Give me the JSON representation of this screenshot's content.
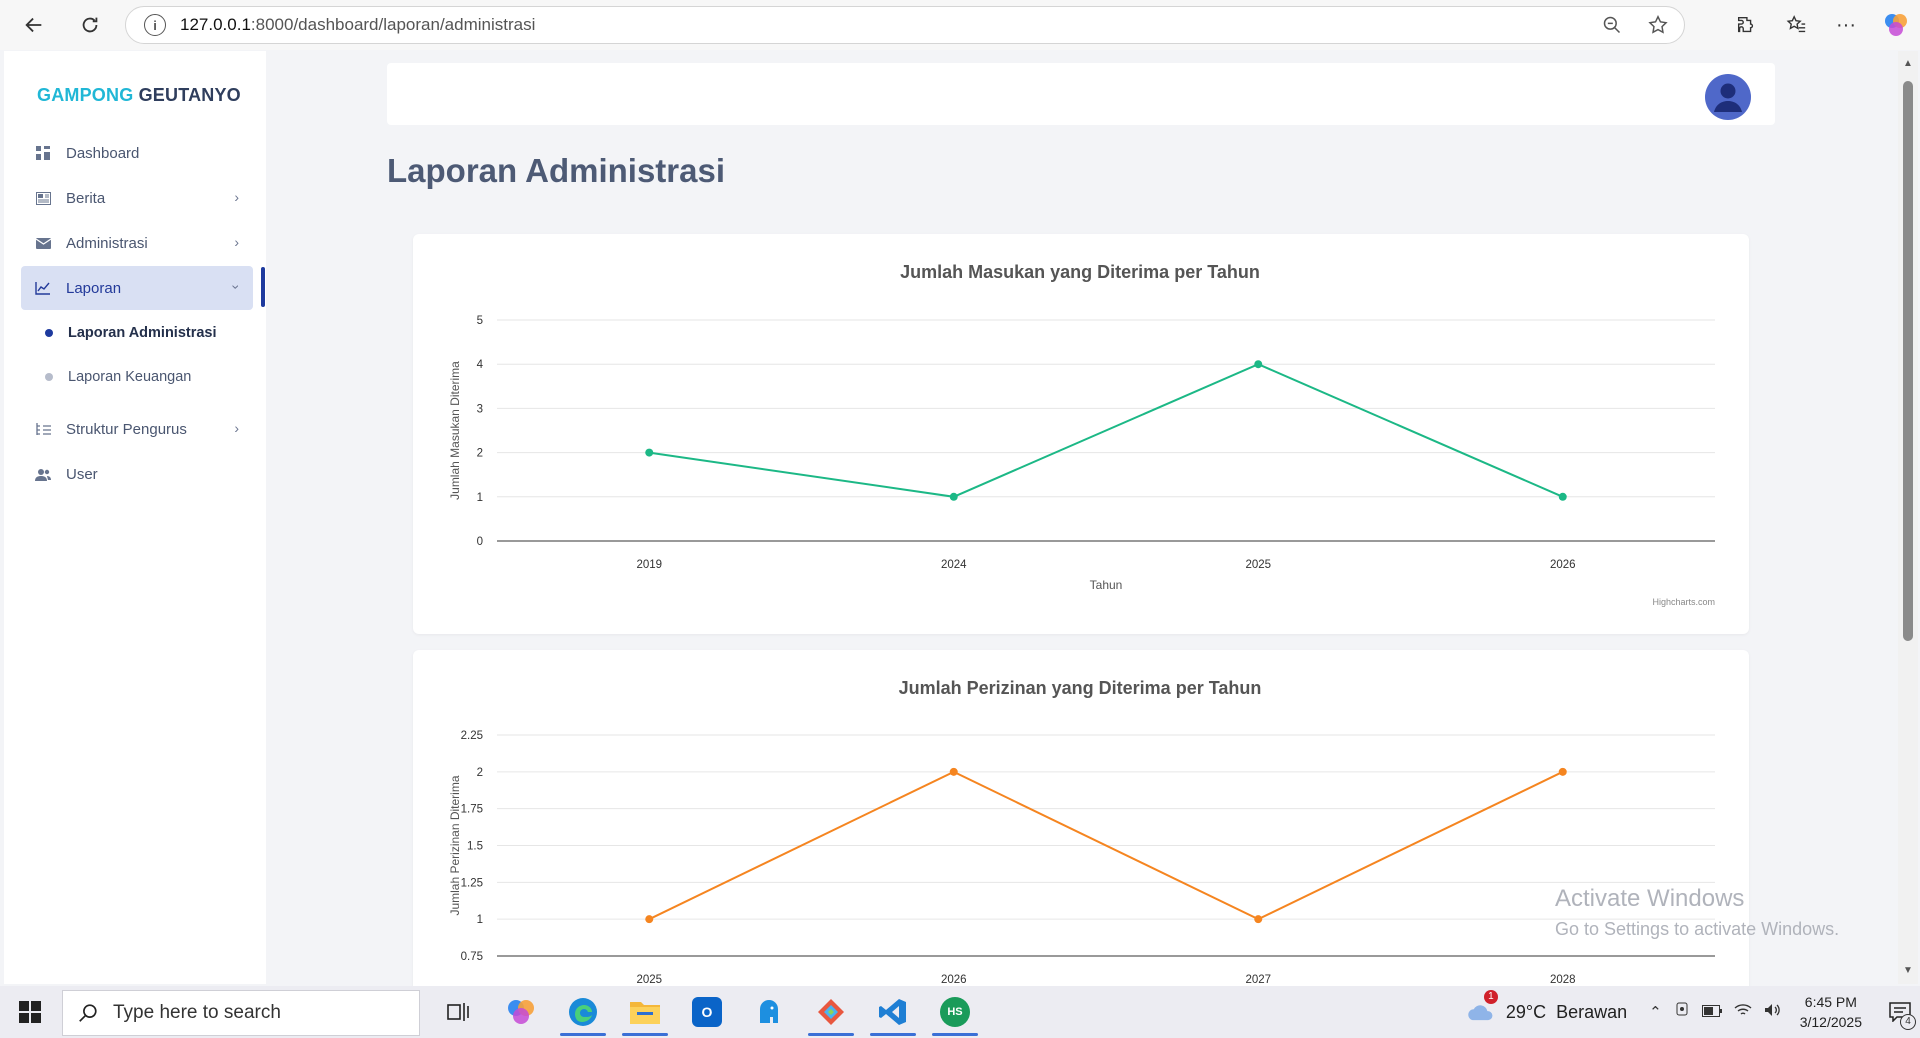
{
  "browser": {
    "url_host": "127.0.0.1",
    "url_path": ":8000/dashboard/laporan/administrasi"
  },
  "sidebar": {
    "brand_part1": "GAMPONG",
    "brand_part2": "GEUTANYO",
    "items": [
      {
        "label": "Dashboard"
      },
      {
        "label": "Berita"
      },
      {
        "label": "Administrasi"
      },
      {
        "label": "Laporan"
      },
      {
        "label": "Struktur Pengurus"
      },
      {
        "label": "User"
      }
    ],
    "submenu": [
      {
        "label": "Laporan Administrasi",
        "active": true
      },
      {
        "label": "Laporan Keuangan",
        "active": false
      }
    ]
  },
  "page": {
    "title": "Laporan Administrasi"
  },
  "chart_data": [
    {
      "type": "line",
      "title": "Jumlah Masukan yang Diterima per Tahun",
      "xlabel": "Tahun",
      "ylabel": "Jumlah Masukan Diterima",
      "categories": [
        "2019",
        "2024",
        "2025",
        "2026"
      ],
      "series": [
        {
          "values": [
            2,
            1,
            4,
            1
          ],
          "color": "#1cb886"
        }
      ],
      "ylim": [
        0,
        5
      ],
      "yticks": [
        "0",
        "1",
        "2",
        "3",
        "4",
        "5"
      ],
      "grid": true,
      "credit": "Highcharts.com"
    },
    {
      "type": "line",
      "title": "Jumlah Perizinan yang Diterima per Tahun",
      "xlabel": "",
      "ylabel": "Jumlah Perizinan Diterima",
      "categories": [
        "2025",
        "2026",
        "2027",
        "2028"
      ],
      "series": [
        {
          "values": [
            1,
            2,
            1,
            2
          ],
          "color": "#f58520"
        }
      ],
      "ylim": [
        0.75,
        2.25
      ],
      "yticks": [
        "0.75",
        "1",
        "1.25",
        "1.5",
        "1.75",
        "2",
        "2.25"
      ],
      "grid": true
    }
  ],
  "watermark": {
    "line1": "Activate Windows",
    "line2": "Go to Settings to activate Windows."
  },
  "taskbar": {
    "search_placeholder": "Type here to search",
    "weather_temp": "29°C",
    "weather_desc": "Berawan",
    "weather_badge": "1",
    "time": "6:45 PM",
    "date": "3/12/2025",
    "notif_count": "4"
  }
}
